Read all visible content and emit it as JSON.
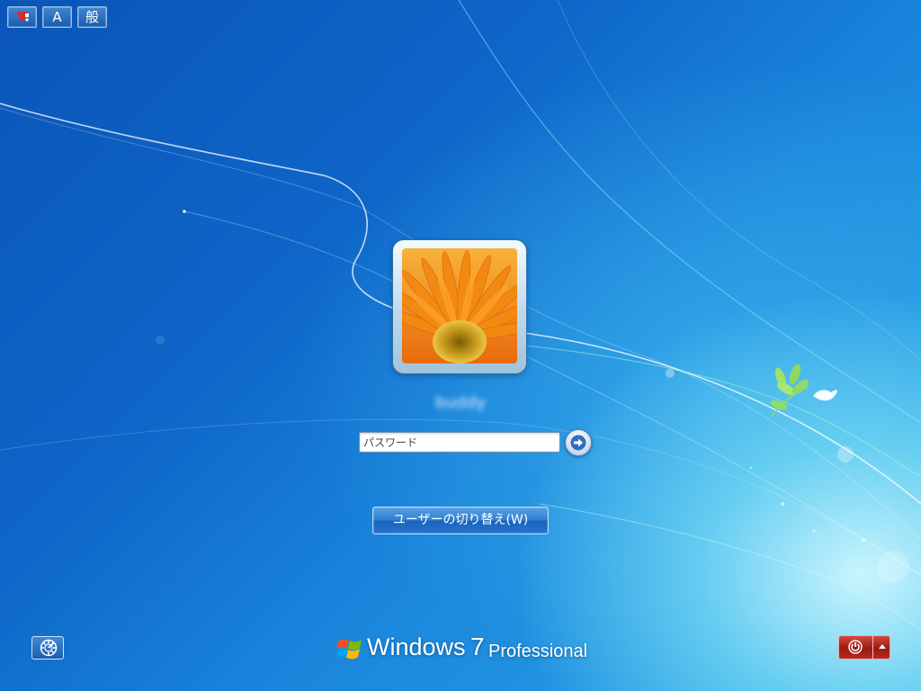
{
  "language_bar": {
    "ime_icon": "ime-status-icon",
    "input_mode_label": "A",
    "conversion_mode_label": "般"
  },
  "user": {
    "username": "buddy",
    "picture": "orange-flower-avatar"
  },
  "password_field": {
    "placeholder": "パスワード",
    "submit_icon": "arrow-right-icon"
  },
  "switch_user": {
    "label": "ユーザーの切り替え(W)"
  },
  "ease_of_access": {
    "icon": "ease-of-access-icon"
  },
  "branding": {
    "name": "Windows",
    "version": "7",
    "edition": "Professional"
  },
  "power": {
    "icon": "power-icon",
    "options_icon": "triangle-up-icon"
  },
  "colors": {
    "background_primary": "#0e66c8",
    "power_button": "#9b1a14"
  }
}
